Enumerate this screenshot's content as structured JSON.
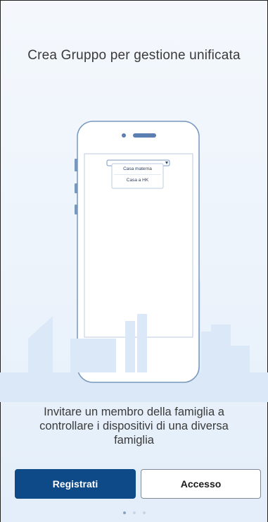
{
  "headline": "Crea Gruppo per gestione unificata",
  "dropdown": {
    "options": [
      "Casa materna",
      "Casa a HK"
    ]
  },
  "caption": "Invitare un membro della famiglia a controllare i dispositivi di una diversa famiglia",
  "buttons": {
    "register_label": "Registrati",
    "login_label": "Accesso"
  },
  "pager": {
    "total": 3,
    "active_index": 0
  },
  "colors": {
    "primary": "#0e4a87",
    "illustration_fill": "#dbe8f7",
    "illustration_stroke": "#7897bd"
  }
}
